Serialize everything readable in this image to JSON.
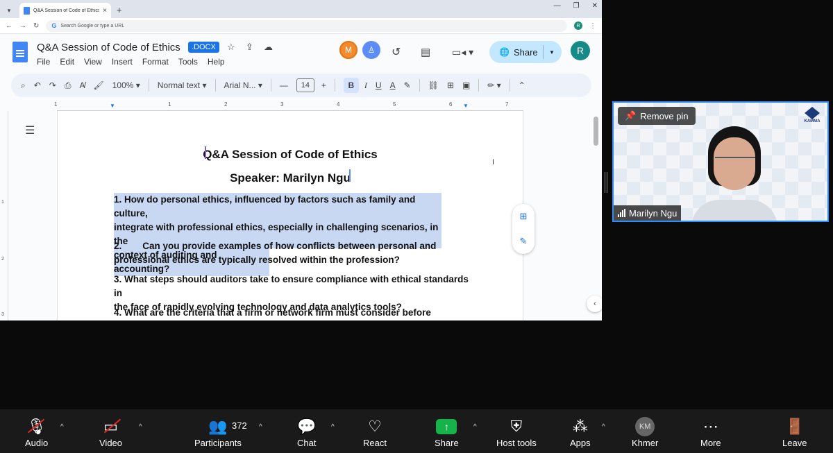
{
  "browser": {
    "tab_title": "Q&A Session of Code of Ethics",
    "omnibox_placeholder": "Search Google or type a URL",
    "profile_initial": "R"
  },
  "docs": {
    "title": "Q&A Session of Code of Ethics",
    "format_badge": ".DOCX",
    "menu": [
      "File",
      "Edit",
      "View",
      "Insert",
      "Format",
      "Tools",
      "Help"
    ],
    "collaborator_initial": "M",
    "share_label": "Share",
    "user_initial": "R",
    "toolbar": {
      "zoom": "100%",
      "style": "Normal text",
      "font": "Arial N...",
      "font_size": "14"
    },
    "ruler_ticks": [
      "1",
      "1",
      "2",
      "3",
      "4",
      "5",
      "6",
      "7"
    ],
    "vruler_ticks": [
      "1",
      "2",
      "3"
    ]
  },
  "document": {
    "heading": "Q&A Session of Code of Ethics",
    "speaker": "Speaker: Marilyn Ngu",
    "q1_lines": [
      "1. How do personal ethics, influenced by factors such as family and culture,",
      "integrate with professional ethics, especially in challenging scenarios, in the",
      "context of auditing and accounting?"
    ],
    "q2_lines": [
      "2.        Can you provide examples of how conflicts between personal and",
      "professional ethics are typically resolved within the profession?"
    ],
    "q3_lines": [
      "3. What steps should auditors take to ensure compliance with ethical standards in",
      "the face of rapidly evolving technology and data analytics tools?"
    ],
    "q4_lines": [
      "4. What are the criteria that a firm or network firm must consider before providing"
    ]
  },
  "video": {
    "pin_label": "Remove pin",
    "participant_name": "Marilyn Ngu",
    "logo_text": "KAMMA",
    "accent": "#2d8cff"
  },
  "controls": {
    "audio": "Audio",
    "video": "Video",
    "participants": "Participants",
    "participant_count": "372",
    "chat": "Chat",
    "react": "React",
    "share": "Share",
    "host_tools": "Host tools",
    "apps": "Apps",
    "language": "Khmer",
    "language_initials": "KM",
    "more": "More",
    "leave": "Leave",
    "share_color": "#16b24a",
    "muted_color": "#e02828"
  }
}
